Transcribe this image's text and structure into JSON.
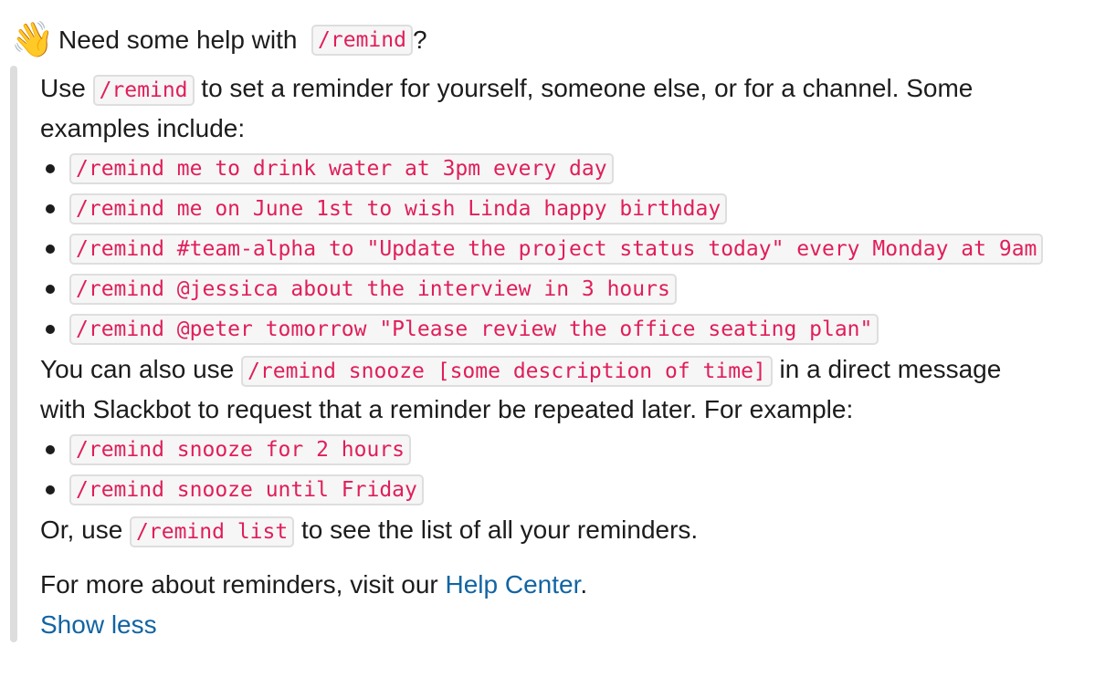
{
  "header": {
    "emoji": "👋",
    "emoji_icon": "waving-hand-icon",
    "text_before": "Need some help with ",
    "code": "/remind",
    "text_after": "?"
  },
  "intro": {
    "text_before": "Use ",
    "code": "/remind",
    "text_after_line1": " to set a reminder for yourself, someone else, or for a channel. Some",
    "text_line2": "examples include:"
  },
  "examples": [
    "/remind me to drink water at 3pm every day",
    "/remind me on June 1st to wish Linda happy birthday",
    "/remind #team-alpha to \"Update the project status today\" every Monday at 9am",
    "/remind @jessica about the interview in 3 hours",
    "/remind @peter tomorrow \"Please review the office seating plan\""
  ],
  "snooze": {
    "text_before": "You can also use ",
    "code": "/remind snooze [some description of time]",
    "text_after_line1": " in a direct message",
    "text_line2": "with Slackbot to request that a reminder be repeated later. For example:"
  },
  "snooze_examples": [
    "/remind snooze for 2 hours",
    "/remind snooze until Friday"
  ],
  "list": {
    "text_before": "Or, use ",
    "code": "/remind list",
    "text_after": " to see the list of all your reminders."
  },
  "footer": {
    "text_before": "For more about reminders, visit our ",
    "link": "Help Center",
    "text_after": "."
  },
  "show_less": "Show less",
  "colors": {
    "code_text": "#e01e5a",
    "link": "#1264a3",
    "bar": "#dddddd"
  }
}
